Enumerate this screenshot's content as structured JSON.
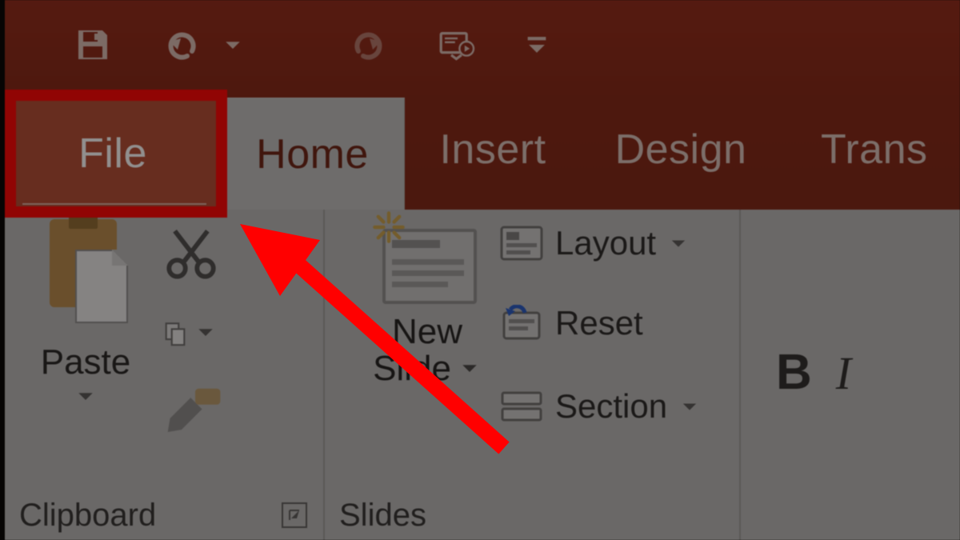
{
  "tabs": {
    "file": "File",
    "home": "Home",
    "insert": "Insert",
    "design": "Design",
    "transitions": "Trans"
  },
  "clipboard": {
    "paste": "Paste",
    "group_label": "Clipboard"
  },
  "slides": {
    "new_slide_line1": "New",
    "new_slide_line2": "Slide",
    "layout": "Layout",
    "reset": "Reset",
    "section": "Section",
    "group_label": "Slides"
  },
  "font": {
    "bold": "B",
    "italic": "I"
  }
}
